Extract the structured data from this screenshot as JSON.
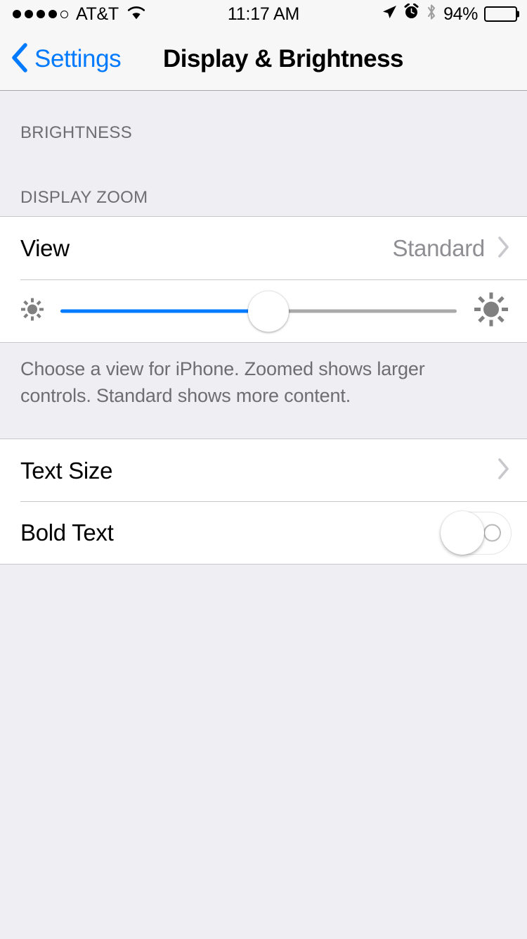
{
  "status_bar": {
    "signal_dots_filled": 4,
    "signal_dots_total": 5,
    "carrier": "AT&T",
    "wifi_icon": "wifi-icon",
    "time": "11:17 AM",
    "location_icon": "location-arrow-icon",
    "alarm_icon": "alarm-clock-icon",
    "bluetooth_icon": "bluetooth-icon",
    "battery_percent": "94%",
    "battery_level": 94
  },
  "nav_bar": {
    "back_icon": "chevron-left-icon",
    "back_label": "Settings",
    "title": "Display & Brightness",
    "accent_color": "#007aff"
  },
  "sections": {
    "brightness_header": "BRIGHTNESS",
    "display_zoom_header": "DISPLAY ZOOM"
  },
  "view_row": {
    "label": "View",
    "value": "Standard",
    "chevron_icon": "chevron-right-icon"
  },
  "brightness_slider": {
    "min_icon": "sun-small-icon",
    "max_icon": "sun-large-icon",
    "value_percent": 52.5,
    "fill_color": "#007aff",
    "track_color": "#a9a9a9"
  },
  "footer_note": "Choose a view for iPhone. Zoomed shows larger controls. Standard shows more content.",
  "text_size_row": {
    "label": "Text Size",
    "chevron_icon": "chevron-right-icon"
  },
  "bold_text_row": {
    "label": "Bold Text",
    "toggle_state": "off",
    "toggle_icon": "toggle-switch-off-icon"
  },
  "colors": {
    "background": "#efeef3",
    "cell_background": "#ffffff",
    "separator": "#c8c7cc",
    "secondary_text": "#8e8e93",
    "header_text": "#6d6d72",
    "accent": "#007aff"
  }
}
